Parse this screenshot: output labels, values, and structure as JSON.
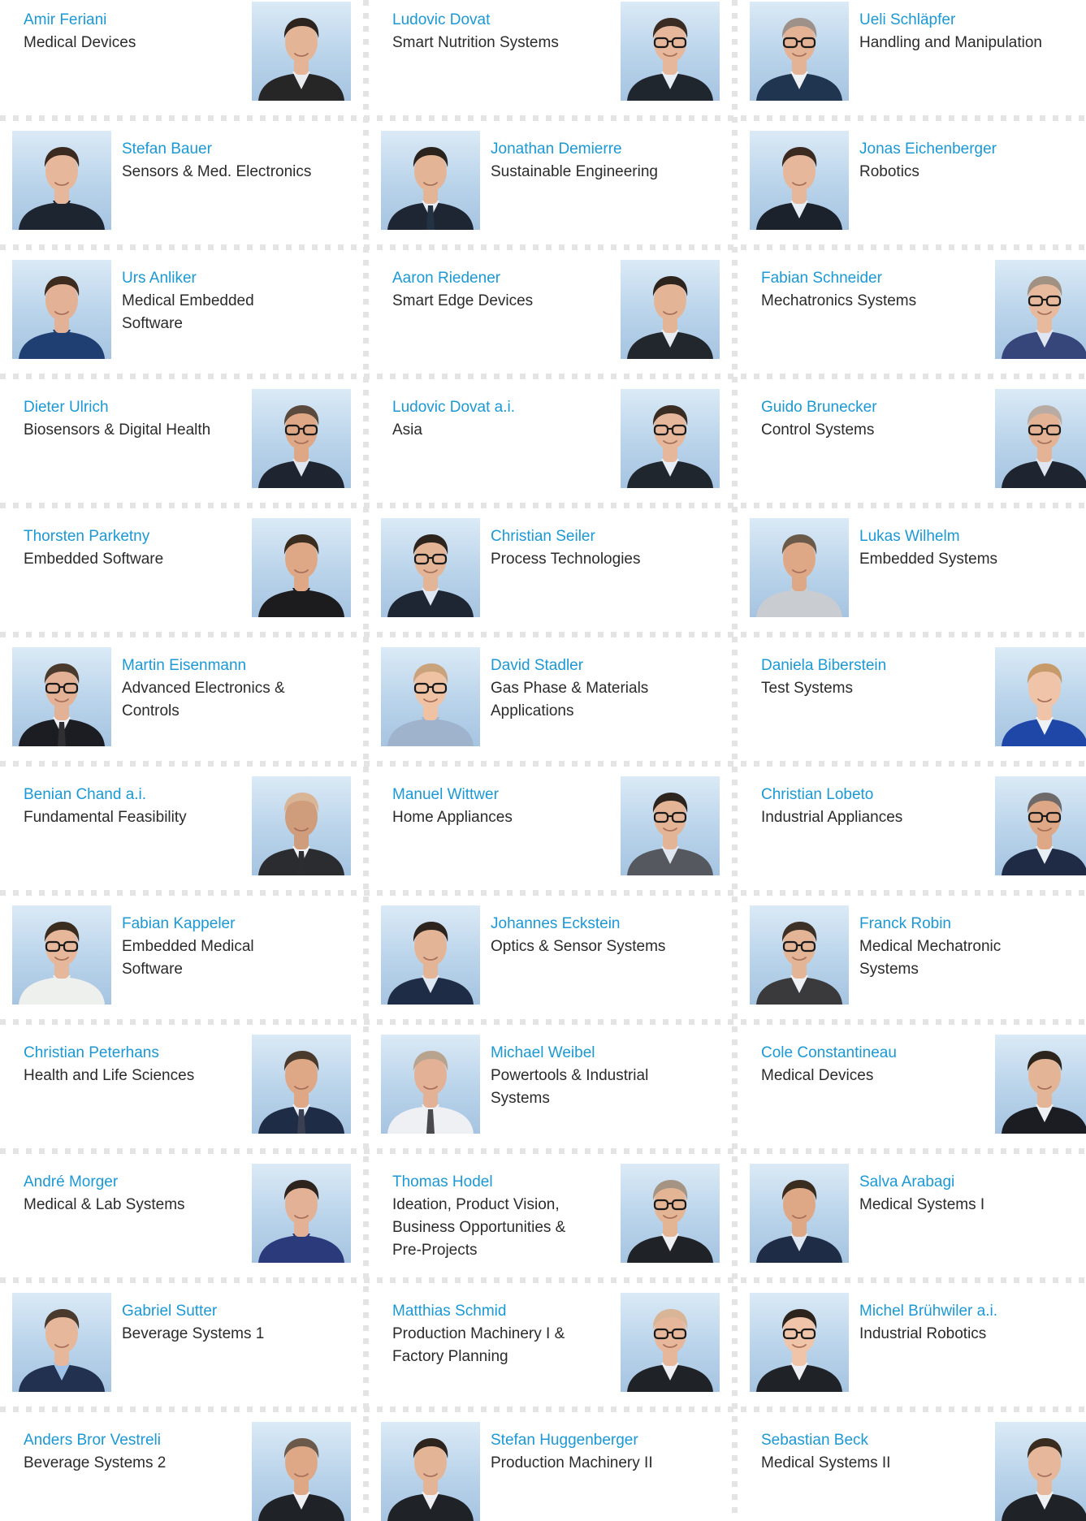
{
  "people": [
    {
      "name": "Amir Feriani",
      "role": "Medical Devices",
      "photo_side": "right",
      "photo": {
        "hair": "#2d241d",
        "jacket": "#262626",
        "shirt": "#e9ecef",
        "glasses": false,
        "skin": "#e3b596",
        "tie": null
      }
    },
    {
      "name": "Ludovic Dovat",
      "role": "Smart Nutrition Systems",
      "photo_side": "right",
      "photo": {
        "hair": "#3a2c22",
        "jacket": "#20262e",
        "shirt": "#e8eef5",
        "glasses": true,
        "skin": "#e6b79a",
        "tie": null
      }
    },
    {
      "name": "Ueli Schläpfer",
      "role": "Handling and Manipulation",
      "photo_side": "left",
      "photo": {
        "hair": "#9d9189",
        "jacket": "#1f3550",
        "shirt": "#eef2f6",
        "glasses": true,
        "skin": "#e4b395",
        "tie": null
      }
    },
    {
      "name": "Stefan Bauer",
      "role": "Sensors & Med. Electronics",
      "photo_side": "left",
      "photo": {
        "hair": "#3b2a20",
        "jacket": "#1d2531",
        "shirt": "#1d2531",
        "glasses": false,
        "skin": "#e6b79a",
        "tie": null
      }
    },
    {
      "name": "Jonathan Demierre",
      "role": "Sustainable Engineering",
      "photo_side": "left",
      "photo": {
        "hair": "#2a221c",
        "jacket": "#1e2633",
        "shirt": "#e8eef5",
        "glasses": false,
        "skin": "#e3b596",
        "tie": "#233243"
      }
    },
    {
      "name": "Jonas Eichenberger",
      "role": "Robotics",
      "photo_side": "left",
      "photo": {
        "hair": "#3a2a20",
        "jacket": "#1b222c",
        "shirt": "#e8eef5",
        "glasses": false,
        "skin": "#e6b79a",
        "tie": null
      }
    },
    {
      "name": "Urs Anliker",
      "role": "Medical Embedded\nSoftware",
      "photo_side": "left",
      "photo": {
        "hair": "#3d2b1f",
        "jacket": "#1f3e72",
        "shirt": "#1f3e72",
        "glasses": false,
        "skin": "#e3b195",
        "tie": null
      }
    },
    {
      "name": "Aaron Riedener",
      "role": "Smart Edge Devices",
      "photo_side": "right",
      "photo": {
        "hair": "#2d241d",
        "jacket": "#22272e",
        "shirt": "#e9edf2",
        "glasses": false,
        "skin": "#e3b596",
        "tie": null
      }
    },
    {
      "name": "Fabian Schneider",
      "role": "Mechatronics Systems",
      "photo_side": "right",
      "photo": {
        "hair": "#a09182",
        "jacket": "#36457a",
        "shirt": "#dfe6f1",
        "glasses": true,
        "skin": "#e7b99d",
        "tie": null
      }
    },
    {
      "name": "Dieter Ulrich",
      "role": "Biosensors & Digital Health",
      "photo_side": "right",
      "photo": {
        "hair": "#5a4a3d",
        "jacket": "#1e2530",
        "shirt": "#dfe6ef",
        "glasses": true,
        "skin": "#dea886",
        "tie": null
      }
    },
    {
      "name": "Ludovic Dovat a.i.",
      "role": "Asia",
      "photo_side": "right",
      "photo": {
        "hair": "#3a2c22",
        "jacket": "#20262e",
        "shirt": "#e8eef5",
        "glasses": true,
        "skin": "#e6b79a",
        "tie": null
      }
    },
    {
      "name": "Guido Brunecker",
      "role": "Control Systems",
      "photo_side": "right",
      "photo": {
        "hair": "#b7aba3",
        "jacket": "#1f2530",
        "shirt": "#dfe6ef",
        "glasses": true,
        "skin": "#e4b395",
        "tie": null
      }
    },
    {
      "name": "Thorsten Parketny",
      "role": "Embedded Software",
      "photo_side": "right",
      "photo": {
        "hair": "#3b2c20",
        "jacket": "#1c1c1e",
        "shirt": "#1c1c1e",
        "glasses": false,
        "skin": "#dea886",
        "tie": null
      }
    },
    {
      "name": "Christian Seiler",
      "role": "Process Technologies",
      "photo_side": "left",
      "photo": {
        "hair": "#2d241d",
        "jacket": "#1e2633",
        "shirt": "#dfe8f2",
        "glasses": true,
        "skin": "#e3b596",
        "tie": null
      }
    },
    {
      "name": "Lukas Wilhelm",
      "role": "Embedded Systems",
      "photo_side": "left",
      "photo": {
        "hair": "#6b5a49",
        "jacket": "#c9ccd1",
        "shirt": "#c9ccd1",
        "glasses": false,
        "skin": "#dea886",
        "tie": null
      }
    },
    {
      "name": "Martin Eisenmann",
      "role": "Advanced Electronics &\nControls",
      "photo_side": "left",
      "photo": {
        "hair": "#4a3a2e",
        "jacket": "#1b1d22",
        "shirt": "#eef0f3",
        "glasses": true,
        "skin": "#e3b195",
        "tie": "#2f2f33"
      }
    },
    {
      "name": "David Stadler",
      "role": "Gas Phase & Materials\nApplications",
      "photo_side": "left",
      "photo": {
        "hair": "#c9a37c",
        "jacket": "#9fb3cc",
        "shirt": "#9fb3cc",
        "glasses": true,
        "skin": "#efc2a4",
        "tie": null
      }
    },
    {
      "name": "Daniela Biberstein",
      "role": "Test Systems",
      "photo_side": "right",
      "photo": {
        "hair": "#c79a6a",
        "jacket": "#1f47a8",
        "shirt": "#eef2f6",
        "glasses": false,
        "skin": "#efc4a8",
        "tie": null
      }
    },
    {
      "name": "Benian Chand a.i.",
      "role": "Fundamental Feasibility",
      "photo_side": "right",
      "photo": {
        "hair": "#d7b596",
        "jacket": "#2a2c30",
        "shirt": "#eef0f3",
        "glasses": false,
        "skin": "#cf9c7c",
        "tie": "#2b2d31"
      }
    },
    {
      "name": "Manuel Wittwer",
      "role": "Home Appliances",
      "photo_side": "right",
      "photo": {
        "hair": "#2d241d",
        "jacket": "#55595f",
        "shirt": "#dfe6ef",
        "glasses": true,
        "skin": "#e3b596",
        "tie": null
      }
    },
    {
      "name": "Christian Lobeto",
      "role": "Industrial Appliances",
      "photo_side": "right",
      "photo": {
        "hair": "#6e6a6a",
        "jacket": "#1f2a45",
        "shirt": "#e8eef5",
        "glasses": true,
        "skin": "#dea886",
        "tie": null
      }
    },
    {
      "name": "Fabian Kappeler",
      "role": "Embedded Medical\nSoftware",
      "photo_side": "left",
      "photo": {
        "hair": "#3b2c20",
        "jacket": "#eef0ee",
        "shirt": "#eef0ee",
        "glasses": true,
        "skin": "#e6b79a",
        "tie": null
      }
    },
    {
      "name": "Johannes Eckstein",
      "role": "Optics & Sensor Systems",
      "photo_side": "left",
      "photo": {
        "hair": "#2d241d",
        "jacket": "#1f2c46",
        "shirt": "#dfe8f2",
        "glasses": false,
        "skin": "#e3b596",
        "tie": null
      }
    },
    {
      "name": "Franck Robin",
      "role": "Medical Mechatronic\nSystems",
      "photo_side": "left",
      "photo": {
        "hair": "#3d3026",
        "jacket": "#3a3a3c",
        "shirt": "#eef0f3",
        "glasses": true,
        "skin": "#e3b596",
        "tie": null
      }
    },
    {
      "name": "Christian Peterhans",
      "role": "Health and Life Sciences",
      "photo_side": "right",
      "photo": {
        "hair": "#4a3a2e",
        "jacket": "#1f2c46",
        "shirt": "#e8eef5",
        "glasses": false,
        "skin": "#dea886",
        "tie": "#3a4052"
      }
    },
    {
      "name": "Michael Weibel",
      "role": "Powertools & Industrial\nSystems",
      "photo_side": "left",
      "photo": {
        "hair": "#b8a48e",
        "jacket": "#eef0f3",
        "shirt": "#eef0f3",
        "glasses": false,
        "skin": "#e3b195",
        "tie": "#4a4a4e"
      }
    },
    {
      "name": "Cole Constantineau",
      "role": "Medical Devices",
      "photo_side": "right",
      "photo": {
        "hair": "#2d241d",
        "jacket": "#1b1d22",
        "shirt": "#eef0f3",
        "glasses": false,
        "skin": "#e3b596",
        "tie": null
      }
    },
    {
      "name": "André Morger",
      "role": "Medical & Lab Systems",
      "photo_side": "right",
      "photo": {
        "hair": "#2d241d",
        "jacket": "#2b3a7a",
        "shirt": "#2b3a7a",
        "glasses": false,
        "skin": "#e3b195",
        "tie": null
      }
    },
    {
      "name": "Thomas Hodel",
      "role": "Ideation, Product Vision,\nBusiness Opportunities &\nPre-Projects",
      "photo_side": "right",
      "photo": {
        "hair": "#a59383",
        "jacket": "#1f2328",
        "shirt": "#eef0f3",
        "glasses": true,
        "skin": "#e3b595",
        "tie": null
      }
    },
    {
      "name": "Salva Arabagi",
      "role": "Medical Systems I",
      "photo_side": "left",
      "photo": {
        "hair": "#3b2c20",
        "jacket": "#1f2c46",
        "shirt": "#dfe8f2",
        "glasses": false,
        "skin": "#dea886",
        "tie": null
      }
    },
    {
      "name": "Gabriel Sutter",
      "role": "Beverage Systems 1",
      "photo_side": "left",
      "photo": {
        "hair": "#4a3a2e",
        "jacket": "#22314f",
        "shirt": "#9ec2e7",
        "glasses": false,
        "skin": "#e6b79a",
        "tie": null
      }
    },
    {
      "name": "Matthias Schmid",
      "role": "Production Machinery I &\nFactory Planning",
      "photo_side": "right",
      "photo": {
        "hair": "#d7b596",
        "jacket": "#1f2328",
        "shirt": "#eef0f3",
        "glasses": true,
        "skin": "#e6b79a",
        "tie": null
      }
    },
    {
      "name": "Michel Brühwiler a.i.",
      "role": "Industrial Robotics",
      "photo_side": "left",
      "photo": {
        "hair": "#2d241d",
        "jacket": "#1f2328",
        "shirt": "#eef0f3",
        "glasses": true,
        "skin": "#efc4a8",
        "tie": null
      }
    },
    {
      "name": "Anders Bror Vestreli",
      "role": "Beverage Systems 2",
      "photo_side": "right",
      "photo": {
        "hair": "#6b5a49",
        "jacket": "#1f2328",
        "shirt": "#eef0f3",
        "glasses": false,
        "skin": "#dea886",
        "tie": null
      }
    },
    {
      "name": "Stefan Huggenberger",
      "role": "Production Machinery II",
      "photo_side": "left",
      "photo": {
        "hair": "#2d241d",
        "jacket": "#1f2328",
        "shirt": "#eef0f3",
        "glasses": false,
        "skin": "#e3b596",
        "tie": null
      }
    },
    {
      "name": "Sebastian Beck",
      "role": "Medical Systems II",
      "photo_side": "right",
      "photo": {
        "hair": "#3b2c20",
        "jacket": "#1f2328",
        "shirt": "#eef0f3",
        "glasses": false,
        "skin": "#e6b79a",
        "tie": null
      }
    }
  ],
  "colors": {
    "name": "#1c98d3",
    "role": "#2b2b2b",
    "separator": "#e4e4e4",
    "photo_background": "#b9d3ea"
  }
}
